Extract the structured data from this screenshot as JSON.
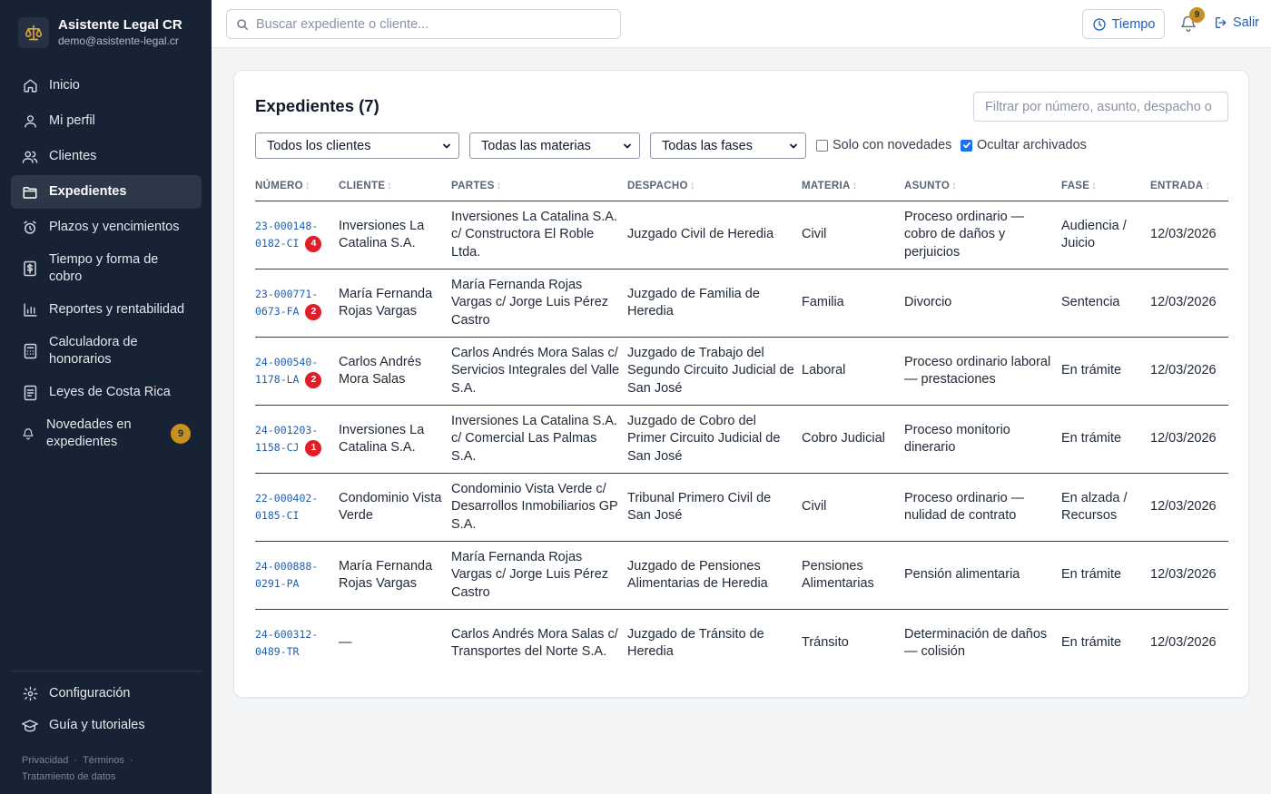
{
  "brand": {
    "name": "Asistente Legal CR",
    "email": "demo@asistente-legal.cr"
  },
  "nav": [
    {
      "label": "Inicio",
      "icon": "home-icon"
    },
    {
      "label": "Mi perfil",
      "icon": "user-icon"
    },
    {
      "label": "Clientes",
      "icon": "users-icon"
    },
    {
      "label": "Expedientes",
      "icon": "folder-icon",
      "active": true
    },
    {
      "label": "Plazos y vencimientos",
      "icon": "alarm-clock-icon"
    },
    {
      "label": "Tiempo y forma de cobro",
      "icon": "billing-icon"
    },
    {
      "label": "Reportes y rentabilidad",
      "icon": "bar-chart-icon"
    },
    {
      "label": "Calculadora de honorarios",
      "icon": "calculator-icon"
    },
    {
      "label": "Leyes de Costa Rica",
      "icon": "book-icon"
    },
    {
      "label": "Novedades en expedientes",
      "icon": "bell-icon",
      "badge": "9"
    }
  ],
  "nav_bottom": [
    {
      "label": "Configuración",
      "icon": "gear-icon"
    },
    {
      "label": "Guía y tutoriales",
      "icon": "graduation-cap-icon"
    }
  ],
  "footer": {
    "privacy": "Privacidad",
    "terms": "Términos",
    "data": "Tratamiento de datos"
  },
  "topbar": {
    "search_placeholder": "Buscar expediente o cliente...",
    "time_button": "Tiempo",
    "bell_count": "9",
    "logout": "Salir"
  },
  "card": {
    "title": "Expedientes (7)",
    "filter_placeholder": "Filtrar por número, asunto, despacho o",
    "selects": {
      "clients": "Todos los clientes",
      "subjects": "Todas las materias",
      "phases": "Todas las fases"
    },
    "checkboxes": {
      "only_news": {
        "label": "Solo con novedades",
        "checked": false
      },
      "hide_archived": {
        "label": "Ocultar archivados",
        "checked": true
      }
    }
  },
  "table": {
    "headers": [
      "NÚMERO",
      "CLIENTE",
      "PARTES",
      "DESPACHO",
      "MATERIA",
      "ASUNTO",
      "FASE",
      "ENTRADA"
    ],
    "rows": [
      {
        "num1": "23-000148-",
        "num2": "0182-CI",
        "badge": "4",
        "cliente": "Inversiones La Catalina S.A.",
        "partes": "Inversiones La Catalina S.A. c/ Constructora El Roble Ltda.",
        "despacho": "Juzgado Civil de Heredia",
        "materia": "Civil",
        "asunto": "Proceso ordinario — cobro de daños y perjuicios",
        "fase": "Audiencia / Juicio",
        "entrada": "12/03/2026"
      },
      {
        "num1": "23-000771-",
        "num2": "0673-FA",
        "badge": "2",
        "cliente": "María Fernanda Rojas Vargas",
        "partes": "María Fernanda Rojas Vargas c/ Jorge Luis Pérez Castro",
        "despacho": "Juzgado de Familia de Heredia",
        "materia": "Familia",
        "asunto": "Divorcio",
        "fase": "Sentencia",
        "entrada": "12/03/2026"
      },
      {
        "num1": "24-000540-",
        "num2": "1178-LA",
        "badge": "2",
        "cliente": "Carlos Andrés Mora Salas",
        "partes": "Carlos Andrés Mora Salas c/ Servicios Integrales del Valle S.A.",
        "despacho": "Juzgado de Trabajo del Segundo Circuito Judicial de San José",
        "materia": "Laboral",
        "asunto": "Proceso ordinario laboral — prestaciones",
        "fase": "En trámite",
        "entrada": "12/03/2026"
      },
      {
        "num1": "24-001203-",
        "num2": "1158-CJ",
        "badge": "1",
        "cliente": "Inversiones La Catalina S.A.",
        "partes": "Inversiones La Catalina S.A. c/ Comercial Las Palmas S.A.",
        "despacho": "Juzgado de Cobro del Primer Circuito Judicial de San José",
        "materia": "Cobro Judicial",
        "asunto": "Proceso monitorio dinerario",
        "fase": "En trámite",
        "entrada": "12/03/2026"
      },
      {
        "num1": "22-000402-",
        "num2": "0185-CI",
        "badge": "",
        "cliente": "Condominio Vista Verde",
        "partes": "Condominio Vista Verde c/ Desarrollos Inmobiliarios GP S.A.",
        "despacho": "Tribunal Primero Civil de San José",
        "materia": "Civil",
        "asunto": "Proceso ordinario — nulidad de contrato",
        "fase": "En alzada / Recursos",
        "entrada": "12/03/2026"
      },
      {
        "num1": "24-000888-",
        "num2": "0291-PA",
        "badge": "",
        "cliente": "María Fernanda Rojas Vargas",
        "partes": "María Fernanda Rojas Vargas c/ Jorge Luis Pérez Castro",
        "despacho": "Juzgado de Pensiones Alimentarias de Heredia",
        "materia": "Pensiones Alimentarias",
        "asunto": "Pensión alimentaria",
        "fase": "En trámite",
        "entrada": "12/03/2026"
      },
      {
        "num1": "24-600312-",
        "num2": "0489-TR",
        "badge": "",
        "cliente": "—",
        "partes": "Carlos Andrés Mora Salas c/ Transportes del Norte S.A.",
        "despacho": "Juzgado de Tránsito de Heredia",
        "materia": "Tránsito",
        "asunto": "Determinación de daños — colisión",
        "fase": "En trámite",
        "entrada": "12/03/2026"
      }
    ]
  },
  "colors": {
    "sidebar": "#172235",
    "link": "#1e5fb4",
    "badge_red": "#e11d2a",
    "badge_gold": "#c79020"
  }
}
